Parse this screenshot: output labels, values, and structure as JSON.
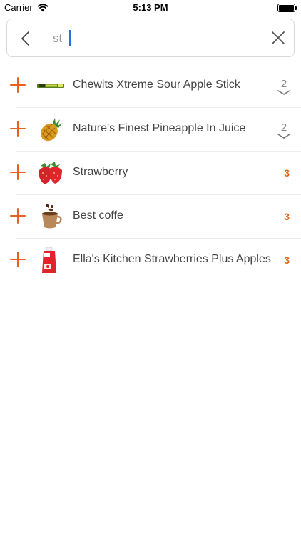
{
  "status": {
    "carrier": "Carrier",
    "time": "5:13 PM"
  },
  "search": {
    "query": "st",
    "placeholder": ""
  },
  "results": [
    {
      "title": "Chewits Xtreme Sour Apple Stick",
      "count": "2",
      "style": "expandable",
      "thumb": "candy-stick-icon"
    },
    {
      "title": "Nature's Finest Pineapple In Juice",
      "count": "2",
      "style": "expandable",
      "thumb": "pineapple-icon"
    },
    {
      "title": "Strawberry",
      "count": "3",
      "style": "accent",
      "thumb": "strawberry-icon"
    },
    {
      "title": "Best coffe",
      "count": "3",
      "style": "accent",
      "thumb": "coffee-cup-icon"
    },
    {
      "title": "Ella's Kitchen Strawberries Plus Apples",
      "count": "3",
      "style": "accent",
      "thumb": "baby-food-pouch-icon"
    }
  ],
  "colors": {
    "accent": "#e8621c",
    "text": "#444444",
    "muted": "#888888",
    "border": "#d9d9d9",
    "separator": "#ececec"
  }
}
